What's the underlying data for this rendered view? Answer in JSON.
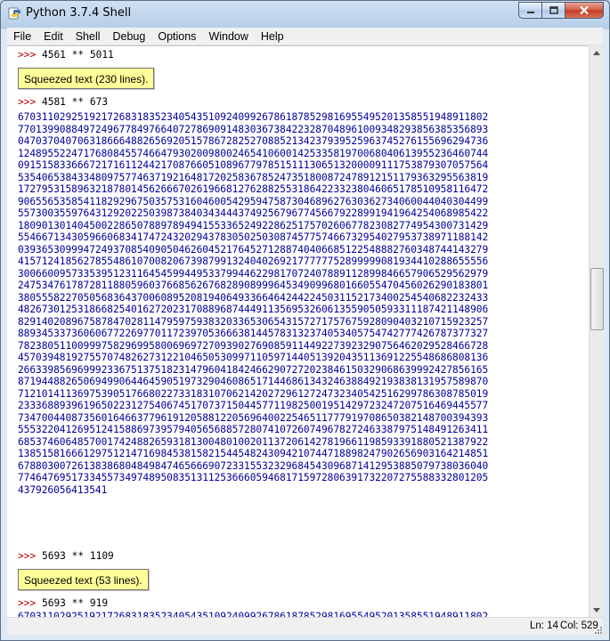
{
  "window": {
    "title": "Python 3.7.4 Shell"
  },
  "menu": [
    "File",
    "Edit",
    "Shell",
    "Debug",
    "Options",
    "Window",
    "Help"
  ],
  "shell": {
    "prompt": ">>>",
    "commands": [
      "4561 ** 5011",
      "4581 ** 673",
      "5693 ** 1109",
      "5693 ** 919"
    ],
    "squeezed": [
      "Squeezed text (230 lines).",
      "Squeezed text (53 lines)."
    ],
    "output_lines": [
      "6703110292519217268318352340543510924099267861878529816955495201358551948911802",
      "7701399088497249677849766407278690914830367384223287048961009348293856385356893",
      "0470370407063186664882656920515786728252708852134237939525963745276155696294736",
      "1248955224717680845574664793020098002465410600142533581970068040613955236460744",
      "0915158336667217161124421708766051089677978515111306513200009111753879307057564",
      "5354065384334809757746371921648172025836785247351800872478912151179363295563819",
      "1727953158963218780145626667026196681276288255318642233238046065178510958116472",
      "9065565358541182929675035753160460054295947587304689627630362734060044040304499",
      "5573003559764312920225039873840343444374925679677456679228991941964254068985422",
      "1809013014045002286507889789494155336524922862517570260677823082774954300731429",
      "5546671343059660683417472432029437830502503087457757466732954027953738971188142",
      "0393653099947249370854090504626045217645271288740406685122548882760348744143279",
      "4157124185627855486107008206739879913240402692177777752899999081934410288655556",
      "3006600957335395123116454599449533799446229817072407889112899846657906529562979",
      "2475347617872811880596037668562676828908999645349099680166055470456026290183801",
      "3805558227050568364370060895208194064933664642442245031152173400254540682232433",
      "4826730125318668254016272023170889687444911356953260613559050593311187421148906",
      "8291402089675878470281147959759383203365306543157271757675928090403210715923257",
      "8893453373606067722697701172397053666381445783132374053405754742777426787377327",
      "7823805110099975829699580069697270939027690859114492273923290756462029528466728",
      "4570394819275570748262731221046505309971105971440513920435113691225548686808136",
      "2663398569699923367513751823147960418424662907272023846150329068639992427856165",
      "8719448826506949906446459051973290460865171446861343246388492193838131957589870",
      "7121014113697539051766802273318310706214202729612724732340542516299786308785019",
      "2333688939619650223127540674517073715044577119825001951429723247207516469445577",
      "7347004408735601646637796191205881220569640022546511777919708650382148700394393",
      "5553220412695124158869739579405656885728074107260749678272463387975148491263411",
      "6853746064857001742488265931813004801002011372061427819661198593391880521387922",
      "1385158166612975121471698453815821544548243094210744718898247902656903164214851",
      "6788030072613838680484984746566690723315532329684543096871412953885079738036040",
      "7746476951733455734974895083513112536660594681715972806391732207275588332801205",
      "437926056413541"
    ]
  },
  "status": {
    "ln": "Ln: 14",
    "col": "Col: 529"
  }
}
